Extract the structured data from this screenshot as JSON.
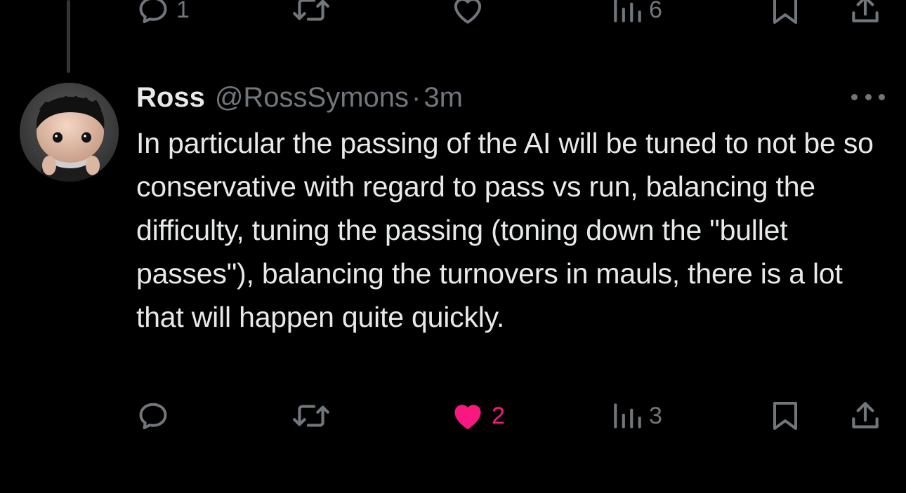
{
  "previous_tweet": {
    "actions": {
      "reply_count": "1",
      "retweet_count": "",
      "like_count": "",
      "views_count": "6"
    }
  },
  "tweet": {
    "author_name": "Ross",
    "author_handle": "@RossSymons",
    "separator": "·",
    "timestamp": "3m",
    "text": "In particular the passing of the AI will be tuned to not be so conservative with regard to pass vs run, balancing the difficulty, tuning the passing (toning down the \"bullet passes\"), balancing the turnovers in mauls, there is a lot that will happen quite quickly.",
    "actions": {
      "reply_count": "",
      "retweet_count": "",
      "like_count": "2",
      "liked": true,
      "views_count": "3"
    }
  },
  "icons": {
    "reply": "reply-icon",
    "retweet": "retweet-icon",
    "like": "heart-icon",
    "views": "views-icon",
    "bookmark": "bookmark-icon",
    "share": "share-icon",
    "more": "more-icon"
  },
  "colors": {
    "background": "#000000",
    "text_primary": "#e7e9ea",
    "text_secondary": "#71767b",
    "like_active": "#f91880",
    "thread_line": "#333639"
  }
}
